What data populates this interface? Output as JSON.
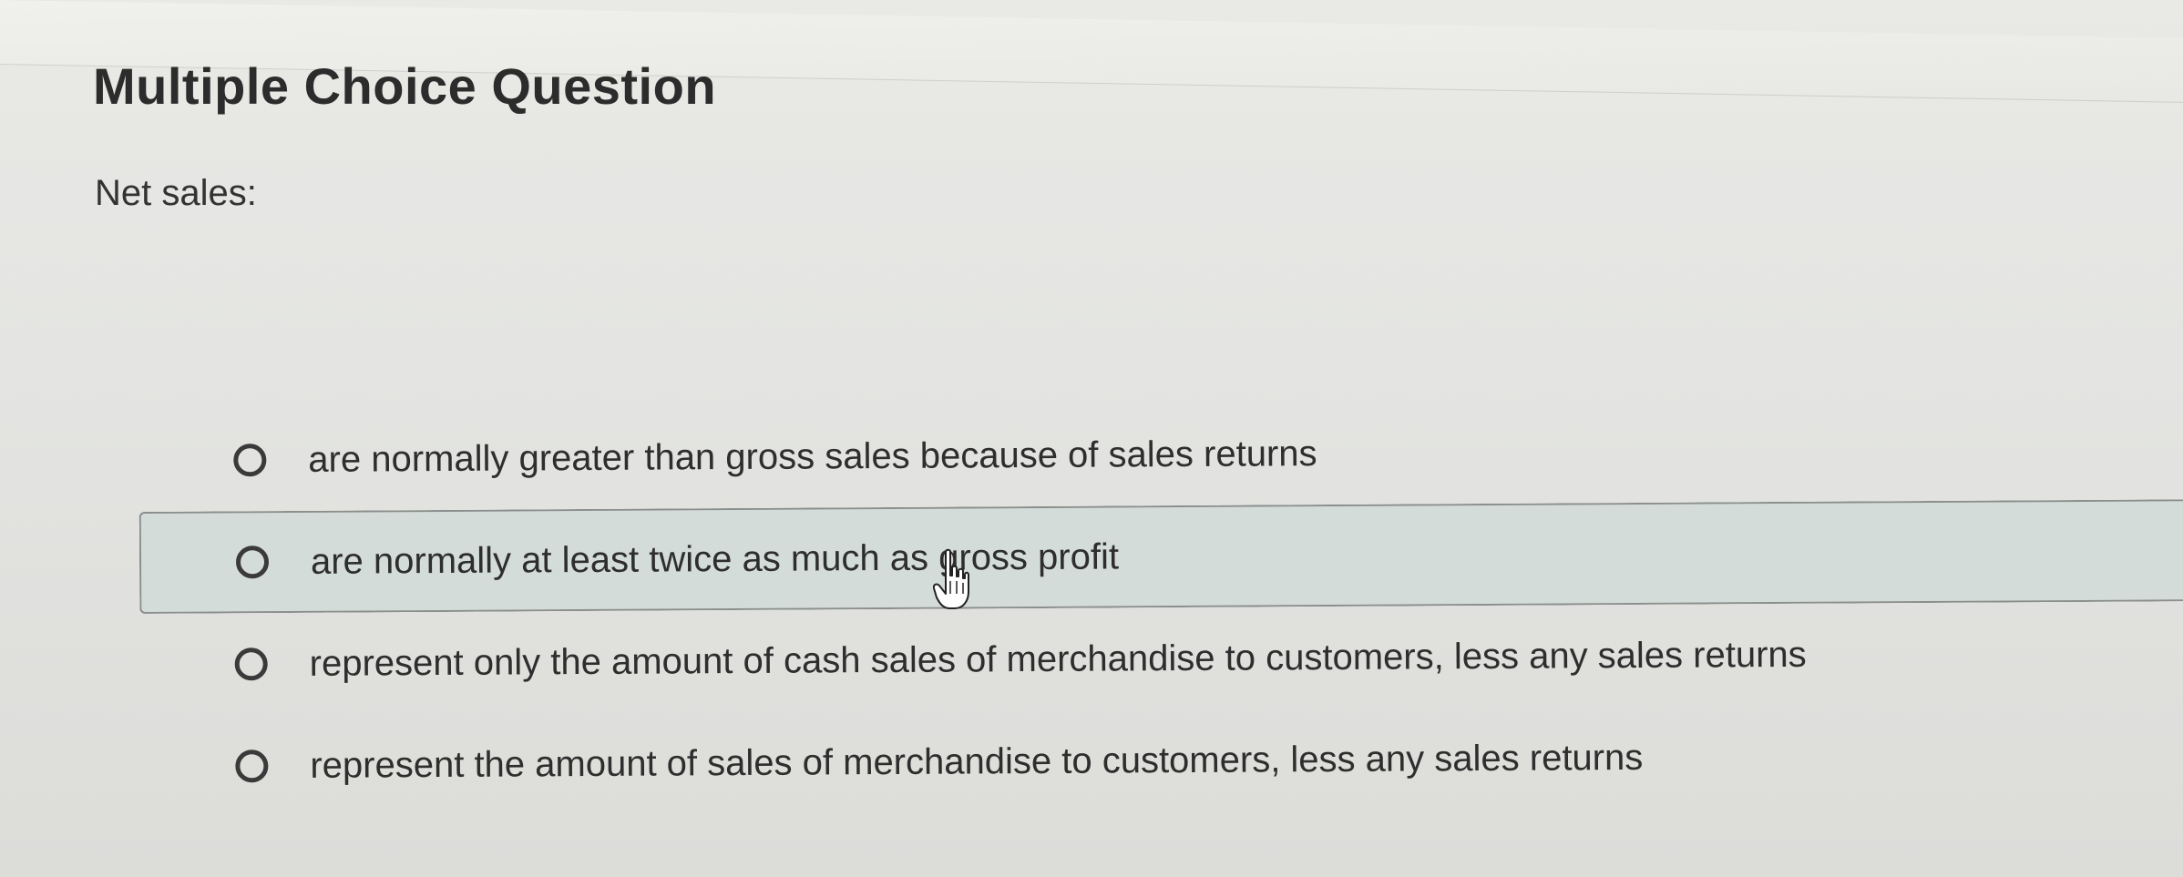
{
  "header": {
    "question_type": "Multiple Choice Question"
  },
  "question": {
    "prompt": "Net sales:"
  },
  "options": [
    {
      "label": "are normally greater than gross sales because of sales returns",
      "selected": false,
      "hovered": false
    },
    {
      "label": "are normally at least twice as much as gross profit",
      "selected": false,
      "hovered": true
    },
    {
      "label": "represent only the amount of cash sales of merchandise to customers, less any sales returns",
      "selected": false,
      "hovered": false
    },
    {
      "label": "represent the amount of sales of merchandise to customers, less any sales returns",
      "selected": false,
      "hovered": false
    }
  ],
  "cursor": {
    "icon": "hand-pointer-icon"
  },
  "colors": {
    "hover_background": "#d4dcd9",
    "text": "#2e2e2e"
  }
}
